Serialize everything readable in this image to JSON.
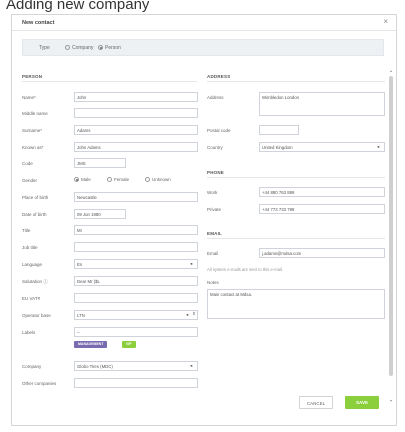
{
  "page": {
    "title": "Adding new company"
  },
  "modal": {
    "title": "New contact"
  },
  "type": {
    "label": "Type",
    "options": [
      "Company",
      "Person"
    ],
    "selected": "Person"
  },
  "person": {
    "heading": "PERSON",
    "name": {
      "label": "Name*",
      "value": "John"
    },
    "middle_name": {
      "label": "Middle name",
      "value": ""
    },
    "surname": {
      "label": "Surname*",
      "value": "Adams"
    },
    "known_as": {
      "label": "Known as*",
      "value": "John Adams"
    },
    "code": {
      "label": "Code",
      "value": "JMS"
    },
    "gender": {
      "label": "Gender",
      "options": [
        "Male",
        "Female",
        "Unknown"
      ],
      "selected": "Male"
    },
    "place_of_birth": {
      "label": "Place of birth",
      "value": "Newcastle"
    },
    "date_of_birth": {
      "label": "Date of birth",
      "value": "09 Jun 1980"
    },
    "title": {
      "label": "Title",
      "value": "Mr"
    },
    "job_title": {
      "label": "Job title",
      "value": ""
    },
    "language": {
      "label": "Language",
      "value": "En"
    },
    "salutation": {
      "label": "Salutation",
      "value": "Dear Mr {$L"
    },
    "eu_vat": {
      "label": "EU VAT#",
      "value": ""
    },
    "operator_base": {
      "label": "Operator base",
      "value": "LTN"
    },
    "labels": {
      "label": "Labels",
      "value": "--",
      "tags": [
        {
          "text": "MANAGEMENT",
          "color": "#7a6bb0"
        },
        {
          "text": "VIP",
          "color": "#8ccf3d"
        }
      ]
    },
    "company": {
      "label": "Company",
      "value": "Globo Tires (MDC)"
    },
    "other_companies": {
      "label": "Other companies",
      "value": ""
    }
  },
  "address": {
    "heading": "ADDRESS",
    "address": {
      "label": "Address",
      "value": "Wimbledon London"
    },
    "postal_code": {
      "label": "Postal code",
      "value": ""
    },
    "country": {
      "label": "Country",
      "value": "United Kingdom"
    }
  },
  "phone": {
    "heading": "PHONE",
    "work": {
      "label": "Work",
      "value": "+44 880 763 899"
    },
    "private": {
      "label": "Private",
      "value": "+44 773 733 798"
    }
  },
  "email": {
    "heading": "EMAIL",
    "email": {
      "label": "Email",
      "value": "j.adams@mdsa.com"
    },
    "note": "All system e-mails are sent to this e-mail.",
    "notes": {
      "label": "Notes",
      "value": "Main contact at Mdsa."
    }
  },
  "buttons": {
    "cancel": "CANCEL",
    "save": "SAVE"
  },
  "icons": {
    "close": "close-icon",
    "dropdown": "dropdown-icon",
    "help": "help-icon",
    "spinner": "spinner-icon"
  },
  "colors": {
    "save": "#8ccf3d",
    "management_tag": "#7a6bb0",
    "vip_tag": "#8ccf3d"
  }
}
